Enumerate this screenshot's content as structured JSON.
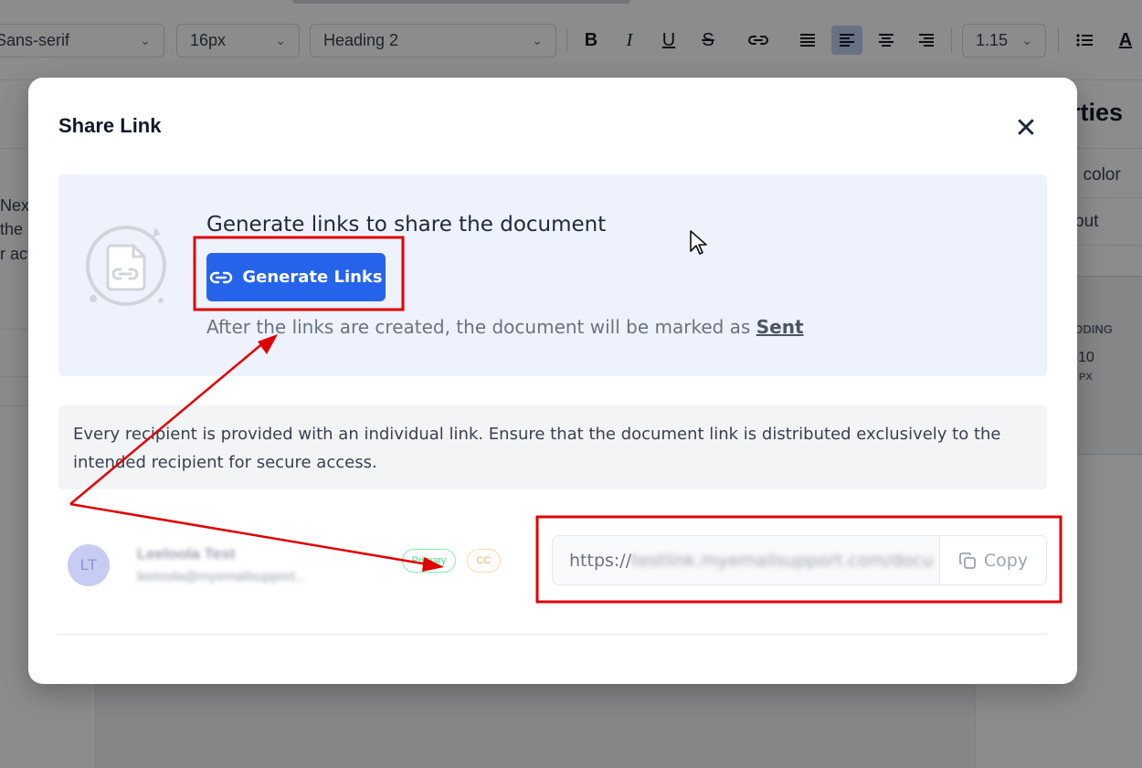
{
  "toolbar": {
    "font_family": "Sans-serif",
    "font_size": "16px",
    "heading": "Heading 2",
    "line_height": "1.15",
    "buttons": [
      "bold-icon",
      "italic-icon",
      "underline-icon",
      "strikethrough-icon",
      "link-icon",
      "align-justify-icon",
      "align-left-icon",
      "align-center-icon",
      "align-right-icon",
      "list-icon",
      "text-color-icon"
    ]
  },
  "left_panel": {
    "lines": [
      "Nex",
      "the",
      "r act"
    ]
  },
  "right_panel": {
    "title": "rties",
    "row1": "l color",
    "row2": "put",
    "padding_label": "DDING",
    "padding_value": "10",
    "padding_unit": "PX"
  },
  "modal": {
    "title": "Share Link",
    "close_symbol": "✕",
    "generate": {
      "heading": "Generate links to share the document",
      "button_label": "Generate Links",
      "note_prefix": "After the links are created, the document will be marked as",
      "note_status": "Sent"
    },
    "info_text": "Every recipient is provided with an individual link. Ensure that the document link is distributed exclusively to the intended recipient for secure access.",
    "recipient": {
      "initials": "LT",
      "name": "Leeloola Test",
      "email": "leeloola@myemailsupport...",
      "badge_primary": "Primary",
      "badge_cc": "CC",
      "link_prefix": "https://",
      "link_rest": "testlink.myemailsupport.com/docu",
      "copy_label": "Copy"
    }
  },
  "colors": {
    "primary": "#2563eb",
    "annotation": "#e00000",
    "panel_bg": "#eef2fd"
  }
}
